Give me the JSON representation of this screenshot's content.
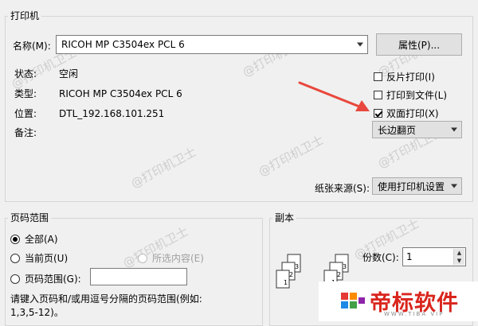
{
  "printer": {
    "group_title": "打印机",
    "name_label": "名称(M):",
    "name_value": "RICOH MP C3504ex PCL 6",
    "properties_button": "属性(P)...",
    "status_label": "状态:",
    "status_value": "空闲",
    "type_label": "类型:",
    "type_value": "RICOH MP C3504ex PCL 6",
    "location_label": "位置:",
    "location_value": "DTL_192.168.101.251",
    "comment_label": "备注:",
    "checkboxes": [
      {
        "label": "反片打印(I)",
        "checked": false
      },
      {
        "label": "打印到文件(L)",
        "checked": false
      },
      {
        "label": "双面打印(X)",
        "checked": true
      }
    ],
    "duplex_mode": "长边翻页",
    "paper_source_label": "纸张来源(S):",
    "paper_source_value": "使用打印机设置"
  },
  "page_range": {
    "group_title": "页码范围",
    "all": "全部(A)",
    "current_page": "当前页(U)",
    "selection": "所选内容(E)",
    "pages": "页码范围(G):",
    "hint_line1": "请键入页码和/或用逗号分隔的页码范围(例如:",
    "hint_line2": "1,3,5-12)。"
  },
  "copies": {
    "group_title": "副本",
    "count_label": "份数(C):",
    "count_value": "1"
  },
  "watermark": "@打印机卫士",
  "brand": {
    "name": "帝标软件",
    "sub": "WWW.TIBA VIP"
  },
  "colors": {
    "arrow": "#e8483d",
    "brand_red": "#d9251d"
  }
}
